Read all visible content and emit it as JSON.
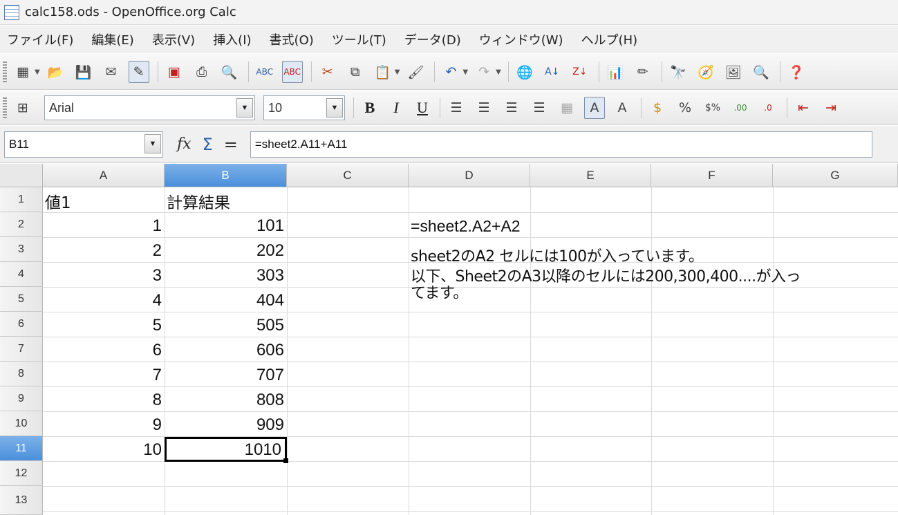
{
  "window": {
    "title": "calc158.ods - OpenOffice.org Calc"
  },
  "menu": [
    "ファイル(F)",
    "編集(E)",
    "表示(V)",
    "挿入(I)",
    "書式(O)",
    "ツール(T)",
    "データ(D)",
    "ウィンドウ(W)",
    "ヘルプ(H)"
  ],
  "format_toolbar": {
    "font_name": "Arial",
    "font_size": "10",
    "bold_label": "B",
    "italic_label": "I",
    "underline_label": "U"
  },
  "formula_bar": {
    "name_box": "B11",
    "fx_label": "fx",
    "sum_label": "Σ",
    "equals_label": "=",
    "formula": "=sheet2.A11+A11"
  },
  "grid": {
    "columns": [
      "A",
      "B",
      "C",
      "D",
      "E",
      "F",
      "G"
    ],
    "selected_column": "B",
    "rows": [
      "1",
      "2",
      "3",
      "4",
      "5",
      "6",
      "7",
      "8",
      "9",
      "10",
      "11",
      "12",
      "13"
    ],
    "selected_row": "11",
    "headers": {
      "A1": "値1",
      "B1": "計算結果"
    },
    "col_a": [
      "1",
      "2",
      "3",
      "4",
      "5",
      "6",
      "7",
      "8",
      "9",
      "10"
    ],
    "col_b": [
      "101",
      "202",
      "303",
      "404",
      "505",
      "606",
      "707",
      "808",
      "909",
      "1010"
    ],
    "d2": "=sheet2.A2+A2",
    "note_line1": "sheet2のA2 セルには100が入っています。",
    "note_line2": "以下、Sheet2のA3以降のセルには200,300,400....が入っ",
    "note_line3": "てます。"
  }
}
